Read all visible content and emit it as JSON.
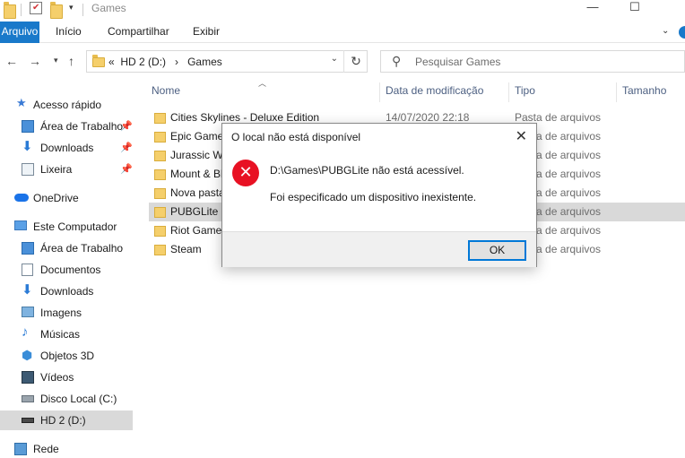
{
  "window": {
    "title": "Games",
    "controls": {
      "minimize": "—",
      "maximize": "☐"
    }
  },
  "ribbon": {
    "tabs": [
      {
        "label": "Arquivo"
      },
      {
        "label": "Início"
      },
      {
        "label": "Compartilhar"
      },
      {
        "label": "Exibir"
      }
    ]
  },
  "address": {
    "prefix": "«",
    "drive": "HD 2 (D:)",
    "arrow": "›",
    "folder": "Games"
  },
  "search": {
    "placeholder": "Pesquisar Games"
  },
  "sidebar": {
    "items": [
      {
        "label": "Acesso rápido",
        "icon": "star-icon",
        "pinned": false
      },
      {
        "label": "Área de Trabalho",
        "icon": "desktop-icon",
        "pinned": true
      },
      {
        "label": "Downloads",
        "icon": "download-icon",
        "pinned": true
      },
      {
        "label": "Lixeira",
        "icon": "recycle-bin-icon",
        "pinned": true
      },
      {
        "label": "OneDrive",
        "icon": "cloud-icon",
        "pinned": false
      },
      {
        "label": "Este Computador",
        "icon": "computer-icon",
        "pinned": false
      },
      {
        "label": "Área de Trabalho",
        "icon": "desktop-icon",
        "pinned": false
      },
      {
        "label": "Documentos",
        "icon": "document-icon",
        "pinned": false
      },
      {
        "label": "Downloads",
        "icon": "download-icon",
        "pinned": false
      },
      {
        "label": "Imagens",
        "icon": "pictures-icon",
        "pinned": false
      },
      {
        "label": "Músicas",
        "icon": "music-icon",
        "pinned": false
      },
      {
        "label": "Objetos 3D",
        "icon": "cube-icon",
        "pinned": false
      },
      {
        "label": "Vídeos",
        "icon": "video-icon",
        "pinned": false
      },
      {
        "label": "Disco Local (C:)",
        "icon": "drive-icon",
        "pinned": false
      },
      {
        "label": "HD 2 (D:)",
        "icon": "drive-icon",
        "pinned": false,
        "selected": true
      },
      {
        "label": "Rede",
        "icon": "network-icon",
        "pinned": false
      }
    ]
  },
  "list": {
    "columns": {
      "name": "Nome",
      "date": "Data de modificação",
      "type": "Tipo",
      "size": "Tamanho"
    },
    "rows": [
      {
        "name": "Cities Skylines - Deluxe Edition",
        "date": "14/07/2020 22:18",
        "type": "Pasta de arquivos"
      },
      {
        "name": "Epic Games",
        "date": "",
        "type": "Pasta de arquivos"
      },
      {
        "name": "Jurassic World",
        "date": "",
        "type": "Pasta de arquivos"
      },
      {
        "name": "Mount & Blade",
        "date": "",
        "type": "Pasta de arquivos"
      },
      {
        "name": "Nova pasta",
        "date": "",
        "type": "Pasta de arquivos"
      },
      {
        "name": "PUBGLite",
        "date": "",
        "type": "Pasta de arquivos",
        "selected": true
      },
      {
        "name": "Riot Games",
        "date": "",
        "type": "Pasta de arquivos"
      },
      {
        "name": "Steam",
        "date": "",
        "type": "Pasta de arquivos"
      }
    ]
  },
  "dialog": {
    "title": "O local não está disponível",
    "message_line1": "D:\\Games\\PUBGLite não está acessível.",
    "message_line2": "Foi especificado um dispositivo inexistente.",
    "ok_label": "OK",
    "close_glyph": "✕",
    "icon": "error-icon",
    "icon_glyph": "✕"
  }
}
